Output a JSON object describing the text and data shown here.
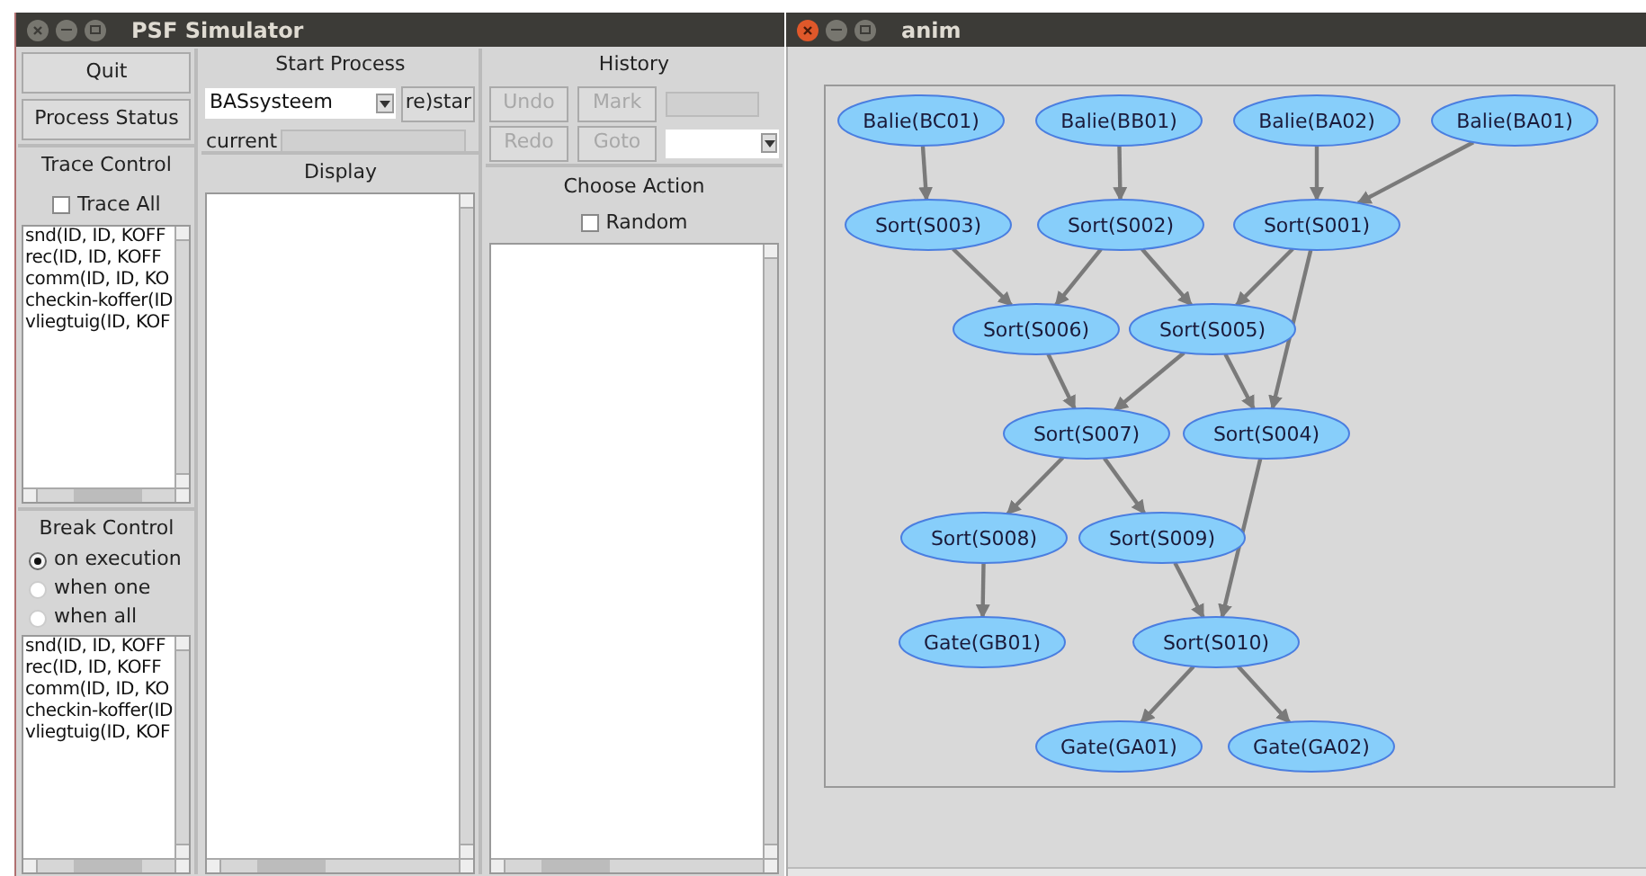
{
  "simulator": {
    "title": "PSF Simulator",
    "buttons": [
      {
        "label": "Quit"
      },
      {
        "label": "Process Status"
      }
    ],
    "trace_control": {
      "title": "Trace Control",
      "trace_all": {
        "label": "Trace All",
        "checked": false
      },
      "items": [
        "snd(ID, ID, KOFF",
        "rec(ID, ID, KOFF",
        "comm(ID, ID, KO",
        "checkin-koffer(ID",
        "vliegtuig(ID, KOF"
      ]
    },
    "break_control": {
      "title": "Break Control",
      "options": [
        {
          "label": "on execution",
          "selected": true
        },
        {
          "label": "when one",
          "selected": false
        },
        {
          "label": "when all",
          "selected": false
        }
      ],
      "items": [
        "snd(ID, ID, KOFF",
        "rec(ID, ID, KOFF",
        "comm(ID, ID, KO",
        "checkin-koffer(ID",
        "vliegtuig(ID, KOF"
      ]
    },
    "start_process": {
      "title": "Start Process",
      "process": {
        "value": "BASsysteem"
      },
      "restart_button": "re)star",
      "current": {
        "label": "current"
      }
    },
    "display": {
      "title": "Display"
    },
    "history": {
      "title": "History",
      "buttons": [
        {
          "kind": "button",
          "label": "Undo",
          "disabled": true
        },
        {
          "kind": "button",
          "label": "Mark",
          "disabled": true
        },
        {
          "kind": "field"
        },
        {
          "kind": "button",
          "label": "Redo",
          "disabled": true
        },
        {
          "kind": "button",
          "label": "Goto",
          "disabled": true
        },
        {
          "kind": "dropdown"
        }
      ]
    },
    "choose_action": {
      "title": "Choose Action",
      "random": {
        "label": "Random",
        "checked": false
      }
    }
  },
  "anim": {
    "title": "anim",
    "nodes": [
      {
        "label": "Balie(BC01)"
      },
      {
        "label": "Balie(BB01)"
      },
      {
        "label": "Balie(BA02)"
      },
      {
        "label": "Balie(BA01)"
      },
      {
        "label": "Sort(S003)"
      },
      {
        "label": "Sort(S002)"
      },
      {
        "label": "Sort(S001)"
      },
      {
        "label": "Sort(S006)"
      },
      {
        "label": "Sort(S005)"
      },
      {
        "label": "Sort(S007)"
      },
      {
        "label": "Sort(S004)"
      },
      {
        "label": "Sort(S008)"
      },
      {
        "label": "Sort(S009)"
      },
      {
        "label": "Gate(GB01)"
      },
      {
        "label": "Sort(S010)"
      },
      {
        "label": "Gate(GA01)"
      },
      {
        "label": "Gate(GA02)"
      }
    ]
  }
}
